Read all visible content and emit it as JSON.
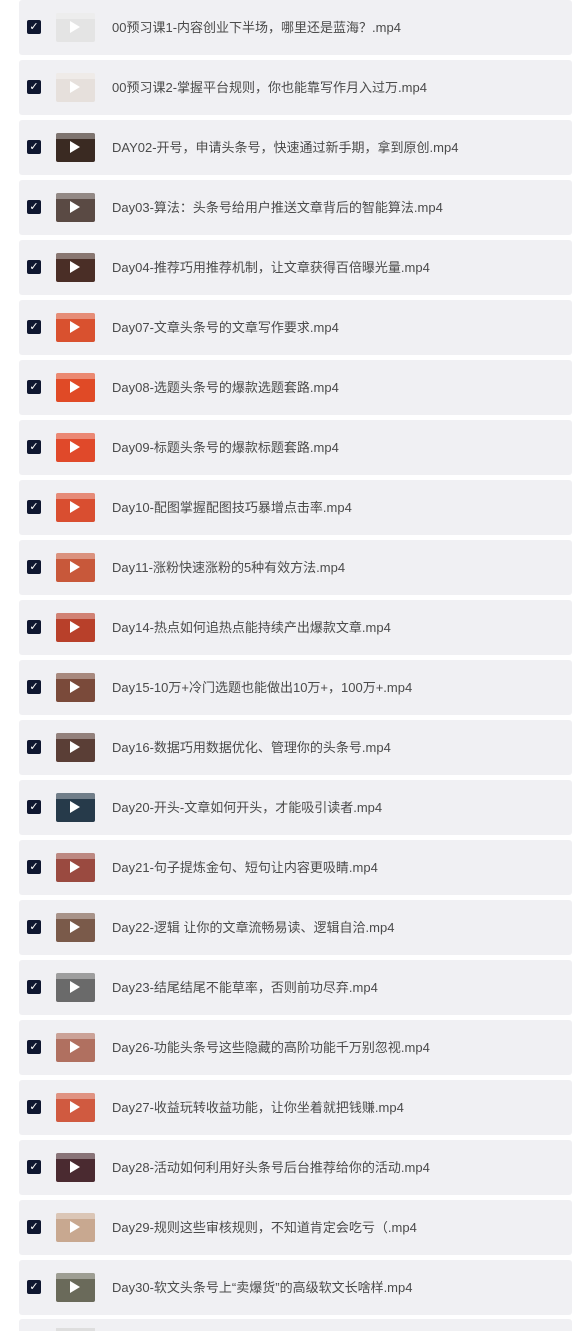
{
  "files": [
    {
      "name": "00预习课1-内容创业下半场，哪里还是蓝海？.mp4",
      "thumb_color": "#e4e4e4",
      "icon": "video-thumbnail"
    },
    {
      "name": "00预习课2-掌握平台规则，你也能靠写作月入过万.mp4",
      "thumb_color": "#e6e0dc",
      "icon": "video-thumbnail"
    },
    {
      "name": "DAY02-开号，申请头条号，快速通过新手期，拿到原创.mp4",
      "thumb_color": "#3a2a22",
      "icon": "video-thumbnail"
    },
    {
      "name": "Day03-算法：头条号给用户推送文章背后的智能算法.mp4",
      "thumb_color": "#5a4a44",
      "icon": "video-thumbnail"
    },
    {
      "name": "Day04-推荐巧用推荐机制，让文章获得百倍曝光量.mp4",
      "thumb_color": "#4a2e26",
      "icon": "video-thumbnail"
    },
    {
      "name": "Day07-文章头条号的文章写作要求.mp4",
      "thumb_color": "#d9512f",
      "icon": "video-thumbnail"
    },
    {
      "name": "Day08-选题头条号的爆款选题套路.mp4",
      "thumb_color": "#e04a26",
      "icon": "video-thumbnail"
    },
    {
      "name": "Day09-标题头条号的爆款标题套路.mp4",
      "thumb_color": "#e0492a",
      "icon": "video-thumbnail"
    },
    {
      "name": "Day10-配图掌握配图技巧暴增点击率.mp4",
      "thumb_color": "#d94e30",
      "icon": "video-thumbnail"
    },
    {
      "name": "Day11-涨粉快速涨粉的5种有效方法.mp4",
      "thumb_color": "#c8583a",
      "icon": "video-thumbnail"
    },
    {
      "name": "Day14-热点如何追热点能持续产出爆款文章.mp4",
      "thumb_color": "#b8402a",
      "icon": "video-thumbnail"
    },
    {
      "name": "Day15-10万+冷门选题也能做出10万+，100万+.mp4",
      "thumb_color": "#7a4a3a",
      "icon": "video-thumbnail"
    },
    {
      "name": "Day16-数据巧用数据优化、管理你的头条号.mp4",
      "thumb_color": "#5a3e36",
      "icon": "video-thumbnail"
    },
    {
      "name": "Day20-开头-文章如何开头，才能吸引读者.mp4",
      "thumb_color": "#263a4a",
      "icon": "video-thumbnail"
    },
    {
      "name": "Day21-句子提炼金句、短句让内容更吸睛.mp4",
      "thumb_color": "#9a4a40",
      "icon": "video-thumbnail"
    },
    {
      "name": "Day22-逻辑 让你的文章流畅易读、逻辑自洽.mp4",
      "thumb_color": "#7a5a4a",
      "icon": "video-thumbnail"
    },
    {
      "name": "Day23-结尾结尾不能草率，否则前功尽弃.mp4",
      "thumb_color": "#6a6a6a",
      "icon": "video-thumbnail"
    },
    {
      "name": "Day26-功能头条号这些隐藏的高阶功能千万别忽视.mp4",
      "thumb_color": "#b07060",
      "icon": "video-thumbnail"
    },
    {
      "name": "Day27-收益玩转收益功能，让你坐着就把钱赚.mp4",
      "thumb_color": "#d05a40",
      "icon": "video-thumbnail"
    },
    {
      "name": "Day28-活动如何利用好头条号后台推荐给你的活动.mp4",
      "thumb_color": "#4a2a30",
      "icon": "video-thumbnail"
    },
    {
      "name": "Day29-规则这些审核规则，不知道肯定会吃亏（.mp4",
      "thumb_color": "#c8a890",
      "icon": "video-thumbnail"
    },
    {
      "name": "Day30-软文头条号上“卖爆货”的高级软文长啥样.mp4",
      "thumb_color": "#6a6a5a",
      "icon": "video-thumbnail"
    }
  ],
  "colors": {
    "row_background": "#f0f0f3",
    "checkbox": "#0f1730",
    "text": "#4a4a4a"
  }
}
